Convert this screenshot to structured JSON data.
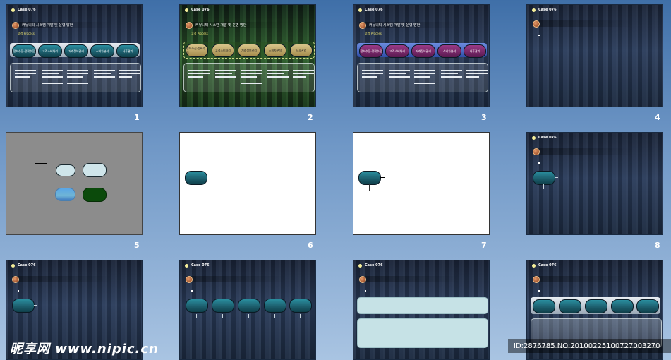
{
  "slide_header": "Case 076",
  "slide_title": "커뮤니티 시스템 개발 및 운영 방안",
  "slide_bullet": "고객 Process",
  "process_steps": [
    "정보수집·정확수집",
    "고객소비처리",
    "거래정보관리",
    "소비자분석",
    "사후관리"
  ],
  "slide_numbers": [
    "1",
    "2",
    "3",
    "4",
    "5",
    "6",
    "7",
    "8"
  ],
  "watermark_left": "昵享网 www.nipic.cn",
  "watermark_right": "ID:2876785 NO:20100225100727003270",
  "colors": {
    "teal_pill": "#1d5f6e",
    "light_pill": "#cfe5ea",
    "dark_green": "#0b4a0b",
    "desktop": "#6f97c6"
  }
}
